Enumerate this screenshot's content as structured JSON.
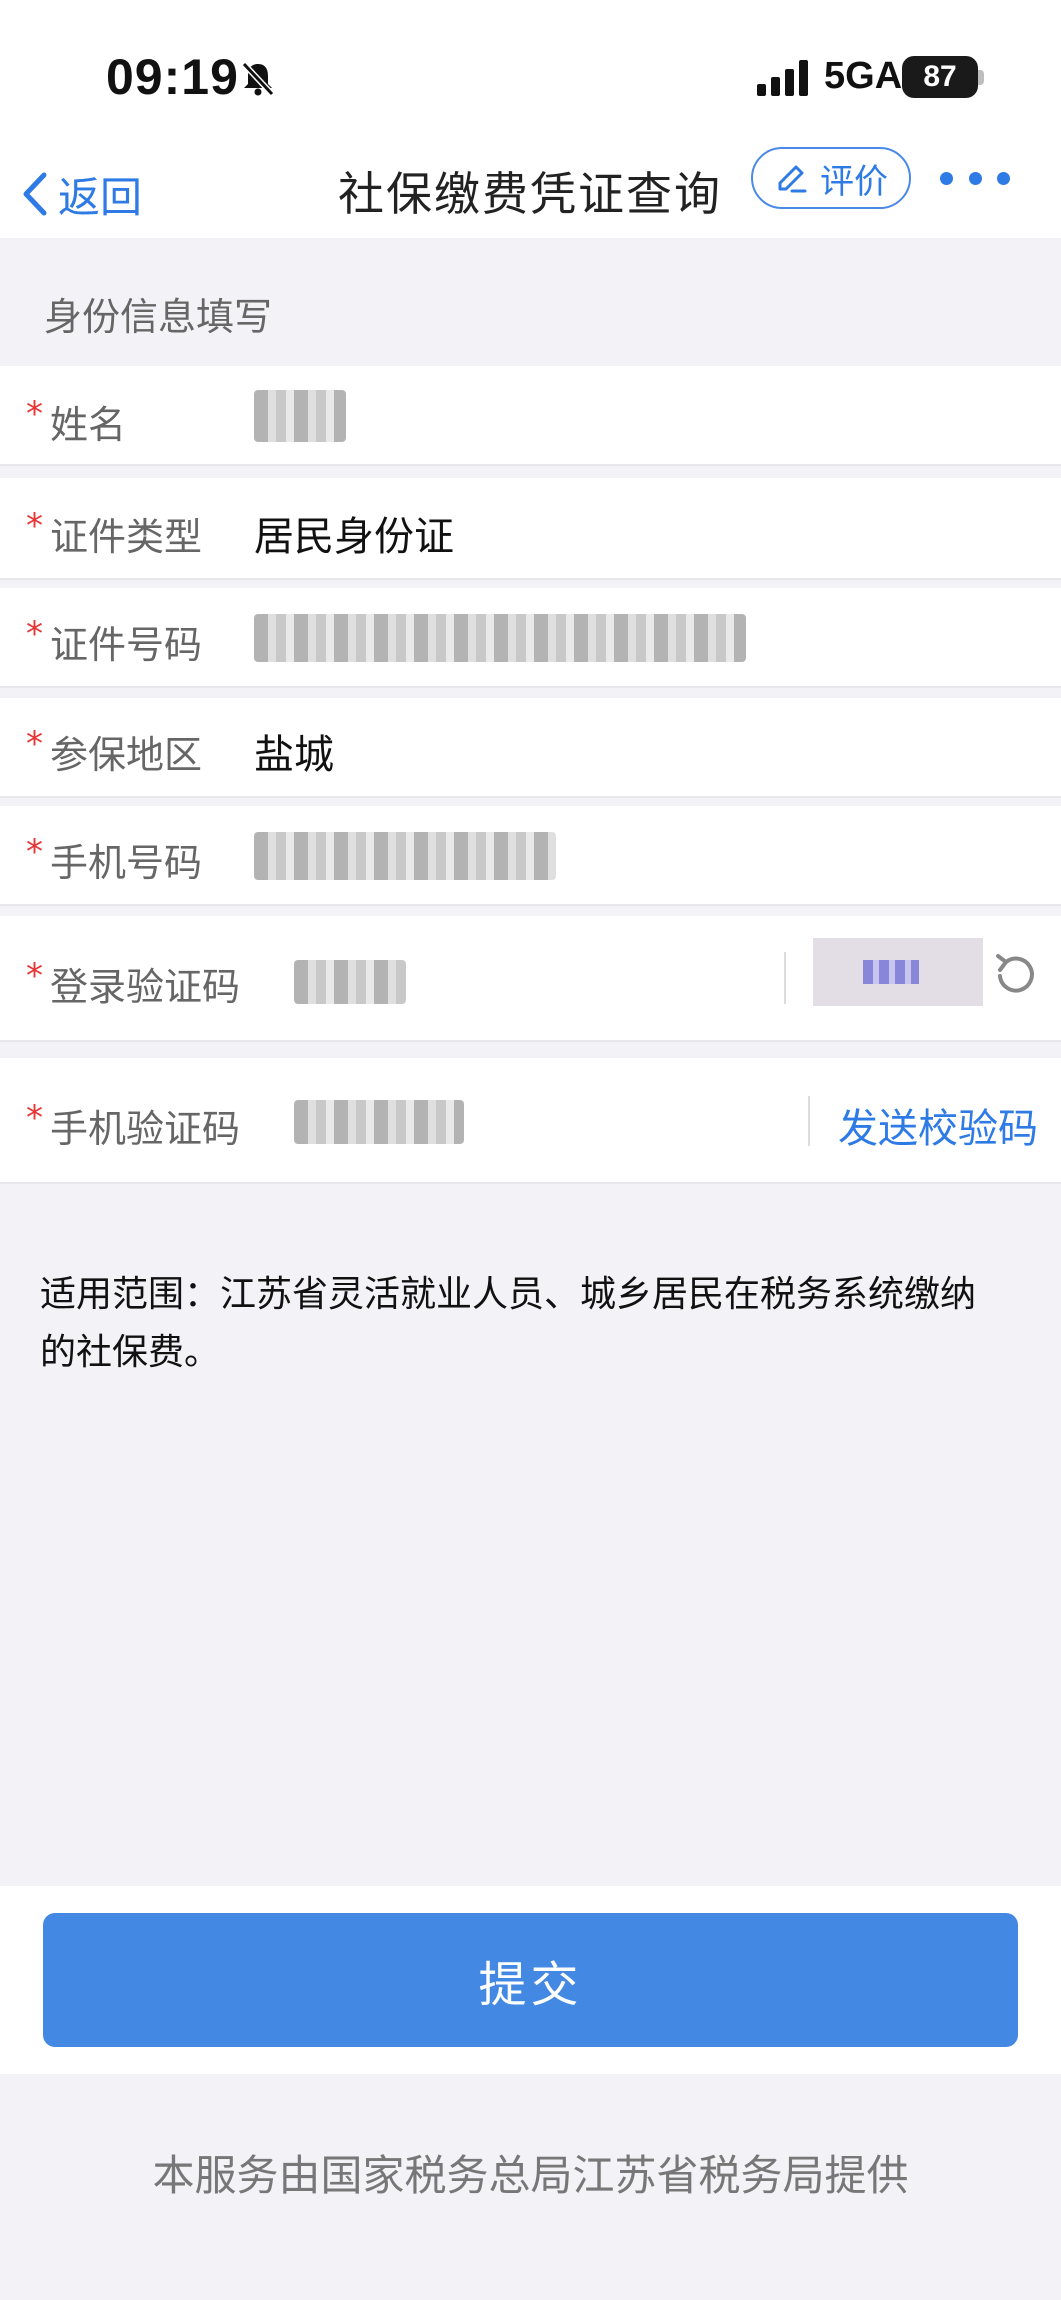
{
  "status_bar": {
    "time": "09:19",
    "network": "5GA",
    "battery": "87"
  },
  "nav": {
    "back_label": "返回",
    "title": "社保缴费凭证查询",
    "rate_label": "评价"
  },
  "section": {
    "title": "身份信息填写"
  },
  "form": {
    "required_mark": "*",
    "name_label": "姓名",
    "id_type_label": "证件类型",
    "id_type_value": "居民身份证",
    "id_number_label": "证件号码",
    "region_label": "参保地区",
    "region_value": "盐城",
    "phone_label": "手机号码",
    "login_code_label": "登录验证码",
    "sms_code_label": "手机验证码",
    "send_code_label": "发送校验码"
  },
  "note": {
    "scope_text": "适用范围：江苏省灵活就业人员、城乡居民在税务系统缴纳的社保费。"
  },
  "actions": {
    "submit_label": "提交"
  },
  "footer": {
    "provider_text": "本服务由国家税务总局江苏省税务局提供"
  },
  "colors": {
    "accent": "#2f7be5",
    "button": "#4389e3",
    "required": "#e63535",
    "background": "#f2f2f7"
  },
  "icons": {
    "back": "chevron-left-icon",
    "rate": "edit-pencil-icon",
    "more": "more-dots-icon",
    "refresh": "refresh-icon",
    "silent": "bell-slash-icon",
    "signal": "signal-bars-icon"
  }
}
